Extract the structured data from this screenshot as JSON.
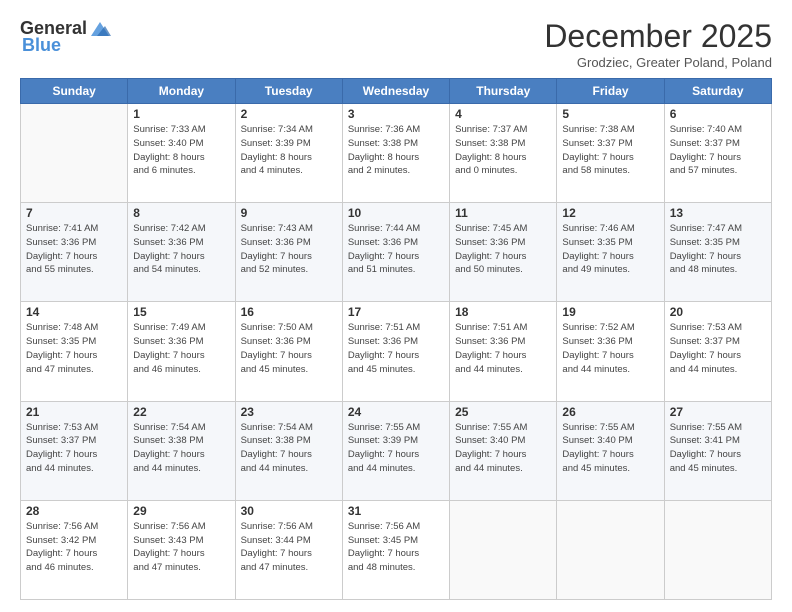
{
  "header": {
    "logo_general": "General",
    "logo_blue": "Blue",
    "month_title": "December 2025",
    "subtitle": "Grodziec, Greater Poland, Poland"
  },
  "days_of_week": [
    "Sunday",
    "Monday",
    "Tuesday",
    "Wednesday",
    "Thursday",
    "Friday",
    "Saturday"
  ],
  "weeks": [
    [
      {
        "day": "",
        "info": ""
      },
      {
        "day": "1",
        "info": "Sunrise: 7:33 AM\nSunset: 3:40 PM\nDaylight: 8 hours\nand 6 minutes."
      },
      {
        "day": "2",
        "info": "Sunrise: 7:34 AM\nSunset: 3:39 PM\nDaylight: 8 hours\nand 4 minutes."
      },
      {
        "day": "3",
        "info": "Sunrise: 7:36 AM\nSunset: 3:38 PM\nDaylight: 8 hours\nand 2 minutes."
      },
      {
        "day": "4",
        "info": "Sunrise: 7:37 AM\nSunset: 3:38 PM\nDaylight: 8 hours\nand 0 minutes."
      },
      {
        "day": "5",
        "info": "Sunrise: 7:38 AM\nSunset: 3:37 PM\nDaylight: 7 hours\nand 58 minutes."
      },
      {
        "day": "6",
        "info": "Sunrise: 7:40 AM\nSunset: 3:37 PM\nDaylight: 7 hours\nand 57 minutes."
      }
    ],
    [
      {
        "day": "7",
        "info": "Sunrise: 7:41 AM\nSunset: 3:36 PM\nDaylight: 7 hours\nand 55 minutes."
      },
      {
        "day": "8",
        "info": "Sunrise: 7:42 AM\nSunset: 3:36 PM\nDaylight: 7 hours\nand 54 minutes."
      },
      {
        "day": "9",
        "info": "Sunrise: 7:43 AM\nSunset: 3:36 PM\nDaylight: 7 hours\nand 52 minutes."
      },
      {
        "day": "10",
        "info": "Sunrise: 7:44 AM\nSunset: 3:36 PM\nDaylight: 7 hours\nand 51 minutes."
      },
      {
        "day": "11",
        "info": "Sunrise: 7:45 AM\nSunset: 3:36 PM\nDaylight: 7 hours\nand 50 minutes."
      },
      {
        "day": "12",
        "info": "Sunrise: 7:46 AM\nSunset: 3:35 PM\nDaylight: 7 hours\nand 49 minutes."
      },
      {
        "day": "13",
        "info": "Sunrise: 7:47 AM\nSunset: 3:35 PM\nDaylight: 7 hours\nand 48 minutes."
      }
    ],
    [
      {
        "day": "14",
        "info": "Sunrise: 7:48 AM\nSunset: 3:35 PM\nDaylight: 7 hours\nand 47 minutes."
      },
      {
        "day": "15",
        "info": "Sunrise: 7:49 AM\nSunset: 3:36 PM\nDaylight: 7 hours\nand 46 minutes."
      },
      {
        "day": "16",
        "info": "Sunrise: 7:50 AM\nSunset: 3:36 PM\nDaylight: 7 hours\nand 45 minutes."
      },
      {
        "day": "17",
        "info": "Sunrise: 7:51 AM\nSunset: 3:36 PM\nDaylight: 7 hours\nand 45 minutes."
      },
      {
        "day": "18",
        "info": "Sunrise: 7:51 AM\nSunset: 3:36 PM\nDaylight: 7 hours\nand 44 minutes."
      },
      {
        "day": "19",
        "info": "Sunrise: 7:52 AM\nSunset: 3:36 PM\nDaylight: 7 hours\nand 44 minutes."
      },
      {
        "day": "20",
        "info": "Sunrise: 7:53 AM\nSunset: 3:37 PM\nDaylight: 7 hours\nand 44 minutes."
      }
    ],
    [
      {
        "day": "21",
        "info": "Sunrise: 7:53 AM\nSunset: 3:37 PM\nDaylight: 7 hours\nand 44 minutes."
      },
      {
        "day": "22",
        "info": "Sunrise: 7:54 AM\nSunset: 3:38 PM\nDaylight: 7 hours\nand 44 minutes."
      },
      {
        "day": "23",
        "info": "Sunrise: 7:54 AM\nSunset: 3:38 PM\nDaylight: 7 hours\nand 44 minutes."
      },
      {
        "day": "24",
        "info": "Sunrise: 7:55 AM\nSunset: 3:39 PM\nDaylight: 7 hours\nand 44 minutes."
      },
      {
        "day": "25",
        "info": "Sunrise: 7:55 AM\nSunset: 3:40 PM\nDaylight: 7 hours\nand 44 minutes."
      },
      {
        "day": "26",
        "info": "Sunrise: 7:55 AM\nSunset: 3:40 PM\nDaylight: 7 hours\nand 45 minutes."
      },
      {
        "day": "27",
        "info": "Sunrise: 7:55 AM\nSunset: 3:41 PM\nDaylight: 7 hours\nand 45 minutes."
      }
    ],
    [
      {
        "day": "28",
        "info": "Sunrise: 7:56 AM\nSunset: 3:42 PM\nDaylight: 7 hours\nand 46 minutes."
      },
      {
        "day": "29",
        "info": "Sunrise: 7:56 AM\nSunset: 3:43 PM\nDaylight: 7 hours\nand 47 minutes."
      },
      {
        "day": "30",
        "info": "Sunrise: 7:56 AM\nSunset: 3:44 PM\nDaylight: 7 hours\nand 47 minutes."
      },
      {
        "day": "31",
        "info": "Sunrise: 7:56 AM\nSunset: 3:45 PM\nDaylight: 7 hours\nand 48 minutes."
      },
      {
        "day": "",
        "info": ""
      },
      {
        "day": "",
        "info": ""
      },
      {
        "day": "",
        "info": ""
      }
    ]
  ]
}
